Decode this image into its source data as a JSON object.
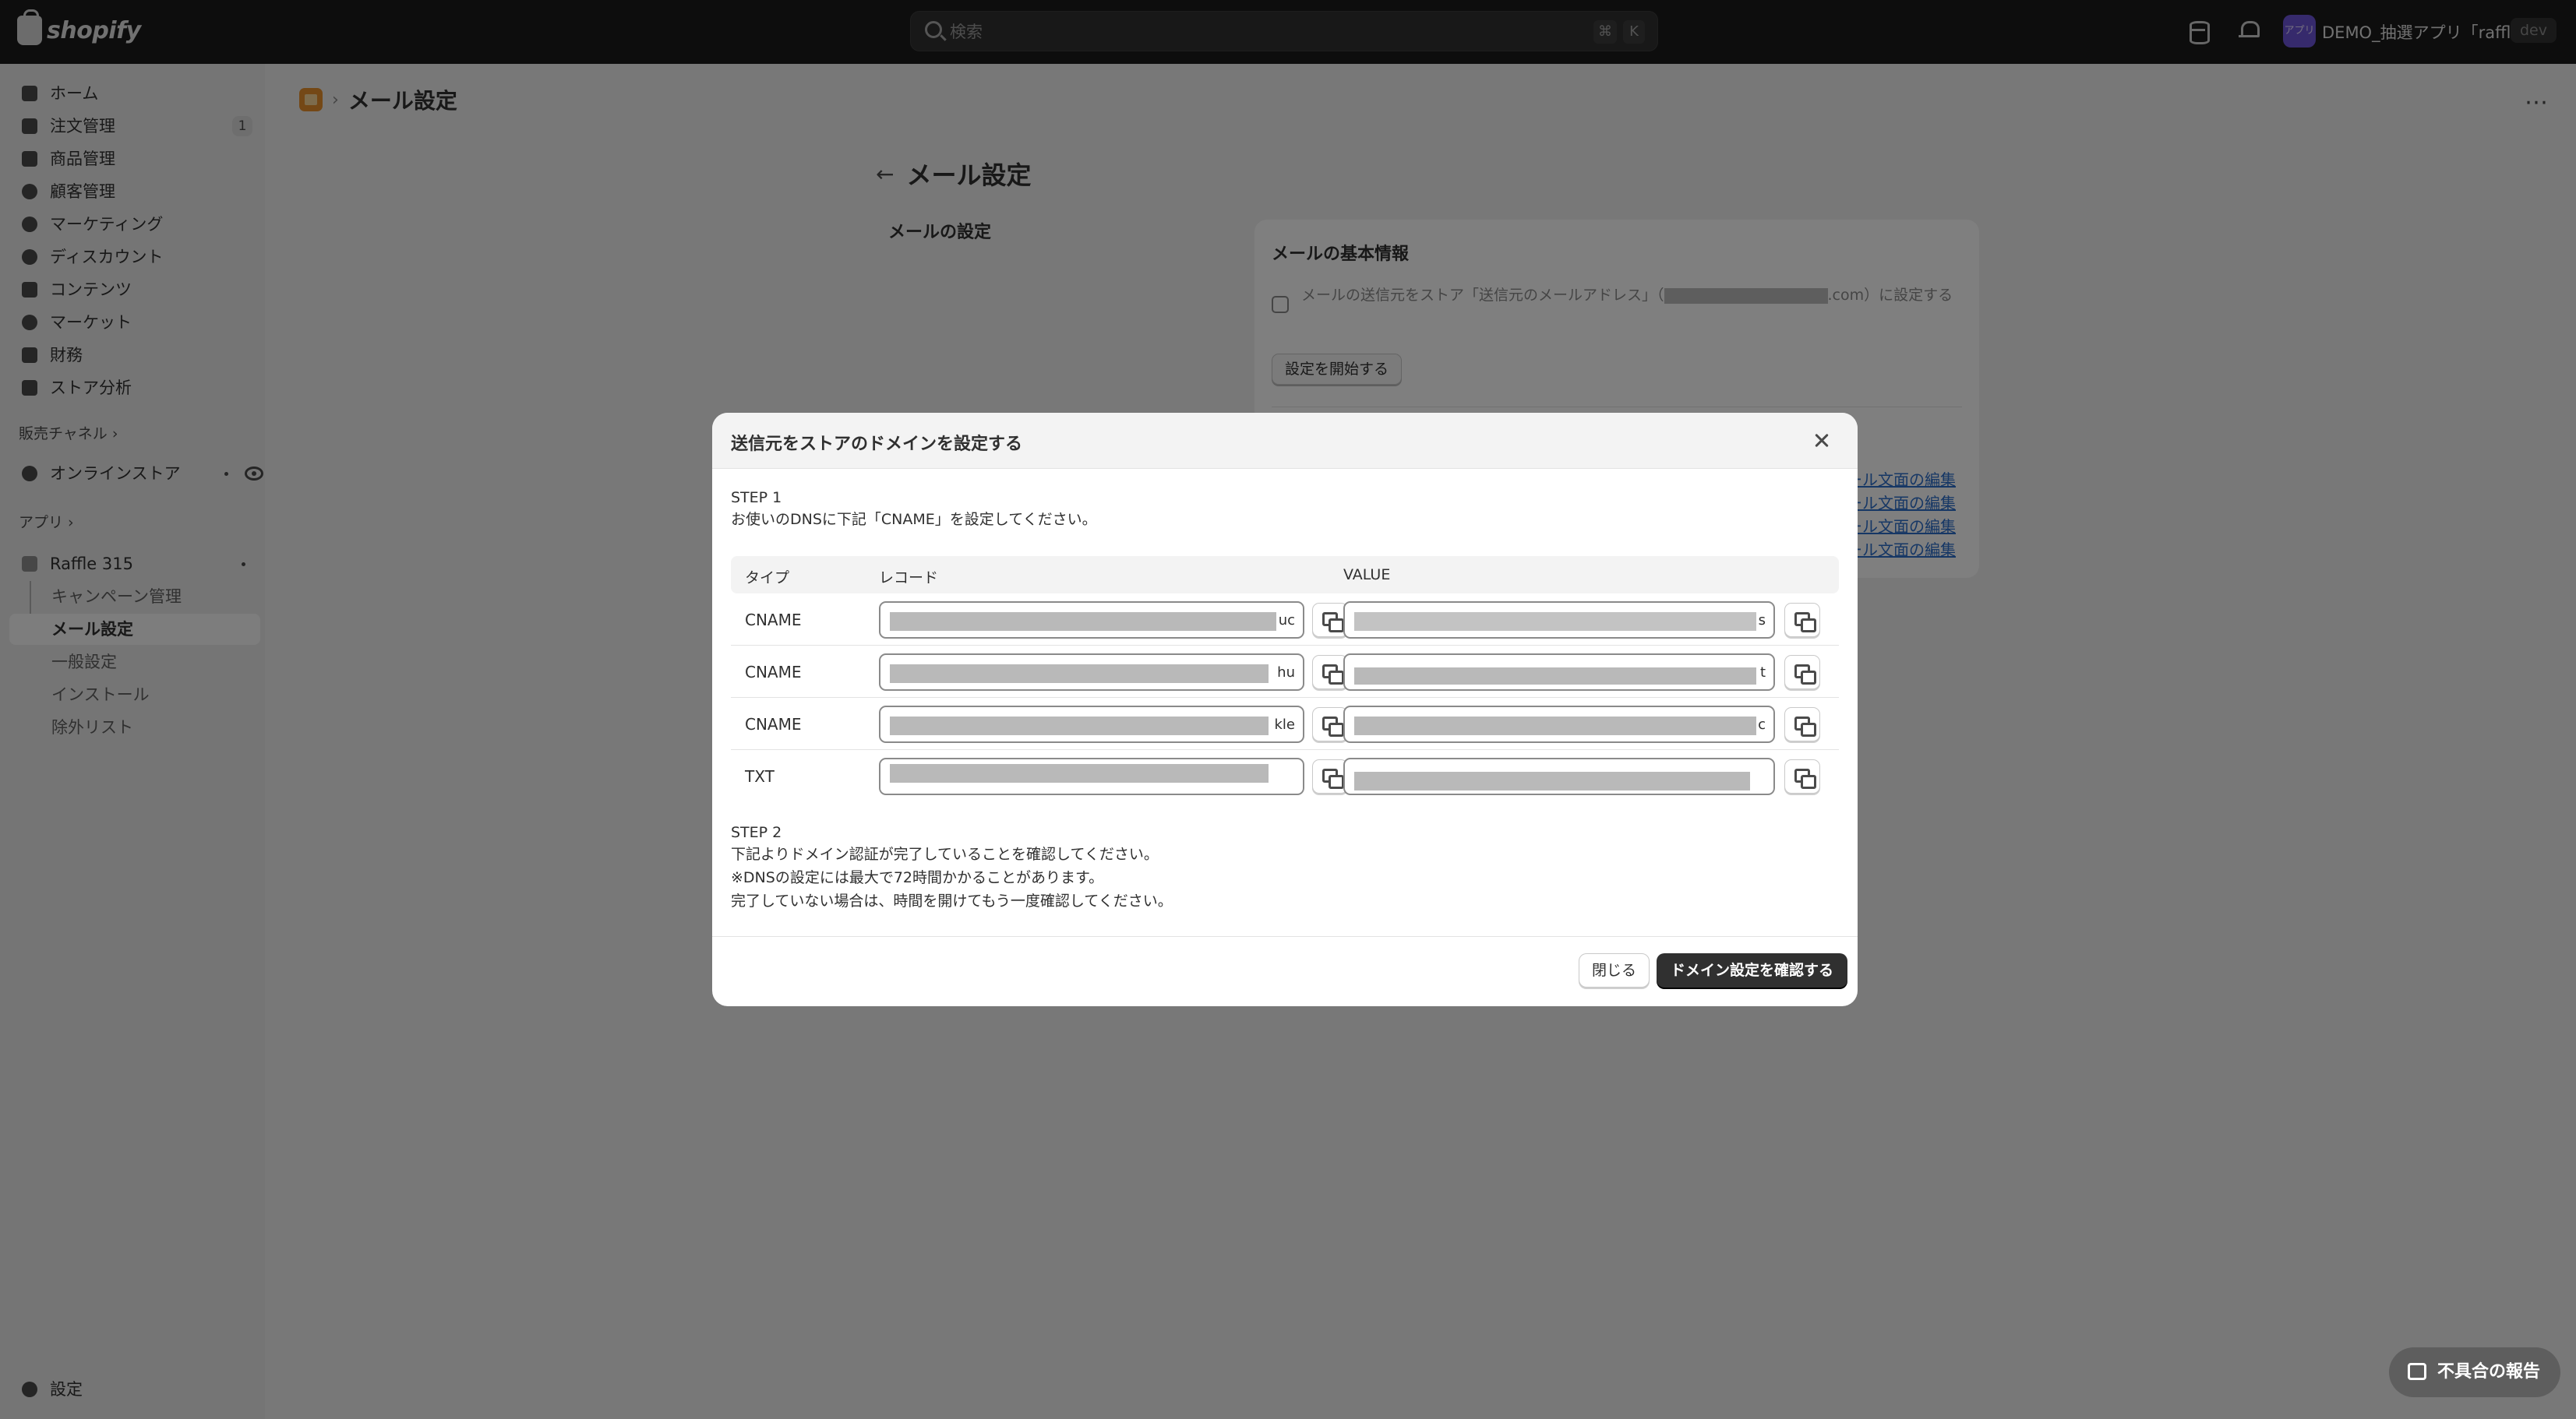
{
  "topbar": {
    "brand": "shopify",
    "search_placeholder": "検索",
    "shortcut_key1": "⌘",
    "shortcut_key2": "K",
    "store_avatar": "アプリ",
    "store_name": "DEMO_抽選アプリ「raffle...",
    "env_badge": "dev"
  },
  "sidebar": {
    "items": [
      {
        "label": "ホーム",
        "icon": "home-icon"
      },
      {
        "label": "注文管理",
        "icon": "orders-icon",
        "count": "1"
      },
      {
        "label": "商品管理",
        "icon": "products-icon"
      },
      {
        "label": "顧客管理",
        "icon": "customers-icon"
      },
      {
        "label": "マーケティング",
        "icon": "marketing-icon"
      },
      {
        "label": "ディスカウント",
        "icon": "discount-icon"
      },
      {
        "label": "コンテンツ",
        "icon": "content-icon"
      },
      {
        "label": "マーケット",
        "icon": "markets-icon"
      },
      {
        "label": "財務",
        "icon": "finance-icon"
      },
      {
        "label": "ストア分析",
        "icon": "analytics-icon"
      }
    ],
    "sales_channels_label": "販売チャネル",
    "online_store_label": "オンラインストア",
    "apps_label": "アプリ",
    "app_name": "Raffle 315",
    "app_sub_items": [
      "キャンペーン管理",
      "メール設定",
      "一般設定",
      "インストール",
      "除外リスト"
    ],
    "settings_label": "設定"
  },
  "page": {
    "breadcrumb_title": "メール設定",
    "title": "メール設定",
    "section_heading": "メールの設定",
    "card_title": "メールの基本情報",
    "card_checkbox_text_before": "メールの送信元をストア「送信元のメールアドレス」（",
    "card_checkbox_text_after": ".com）に設定する",
    "card_button": "設定を開始する",
    "card_link": "ール文面の編集"
  },
  "modal": {
    "title": "送信元をストアのドメインを設定する",
    "step1_label": "STEP 1",
    "step1_text": "お使いのDNSに下記「CNAME」を設定してください。",
    "columns": [
      "タイプ",
      "レコード",
      "VALUE"
    ],
    "rows": [
      {
        "type": "CNAME",
        "record_tail": "uc",
        "value_tail": "s"
      },
      {
        "type": "CNAME",
        "record_tail": "hu",
        "value_tail": "t"
      },
      {
        "type": "CNAME",
        "record_tail": "kle",
        "value_tail": "c"
      },
      {
        "type": "TXT",
        "record_tail": "",
        "value_tail": ""
      }
    ],
    "step2_label": "STEP 2",
    "step2_lines": [
      "下記よりドメイン認証が完了していることを確認してください。",
      "※DNSの設定には最大で72時間かかることがあります。",
      "完了していない場合は、時間を開けてもう一度確認してください。"
    ],
    "close_button": "閉じる",
    "confirm_button": "ドメイン設定を確認する"
  },
  "report_button": "不具合の報告"
}
